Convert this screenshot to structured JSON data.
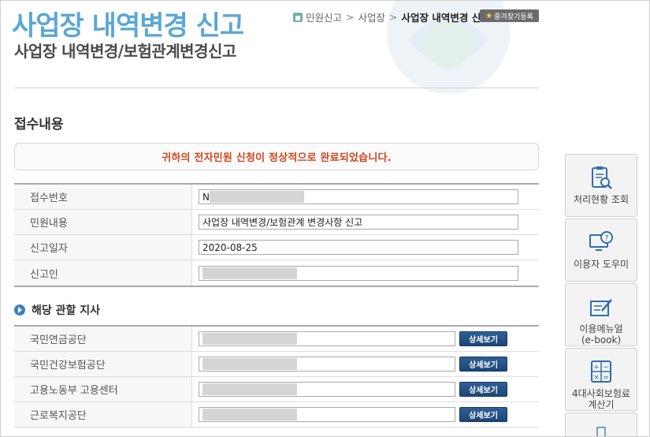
{
  "header": {
    "title": "사업장 내역변경 신고",
    "subtitle": "사업장 내역변경/보험관계변경신고",
    "breadcrumb": [
      "민원신고",
      "사업장",
      "사업장 내역변경 신고"
    ],
    "favorite_label": "즐겨찾기등록"
  },
  "section_title": "접수내용",
  "notice": "귀하의 전자민원 신청이 정상적으로 완료되었습니다.",
  "info_rows": [
    {
      "label": "접수번호",
      "value": "N"
    },
    {
      "label": "민원내용",
      "value": "사업장 내역변경/보험관계 변경사항 신고"
    },
    {
      "label": "신고일자",
      "value": "2020-08-25"
    },
    {
      "label": "신고인",
      "value": ""
    }
  ],
  "agency_section_title": "해당 관할 지사",
  "agencies": [
    {
      "label": "국민연금공단",
      "button": "상세보기"
    },
    {
      "label": "국민건강보험공단",
      "button": "상세보기"
    },
    {
      "label": "고용노동부 고용센터",
      "button": "상세보기"
    },
    {
      "label": "근로복지공단",
      "button": "상세보기"
    }
  ],
  "quick_menu": [
    {
      "label": "처리현황 조회",
      "icon": "clipboard-search-icon"
    },
    {
      "label": "이용자 도우미",
      "icon": "monitor-help-icon"
    },
    {
      "label": "이용메뉴얼\n(e-book)",
      "icon": "edit-document-icon"
    },
    {
      "label": "4대사회보험료\n계산기",
      "icon": "calculator-icon"
    }
  ],
  "colors": {
    "title_blue": "#5aa7d6",
    "notice_red": "#d0461f",
    "button_navy": "#1d4676"
  }
}
